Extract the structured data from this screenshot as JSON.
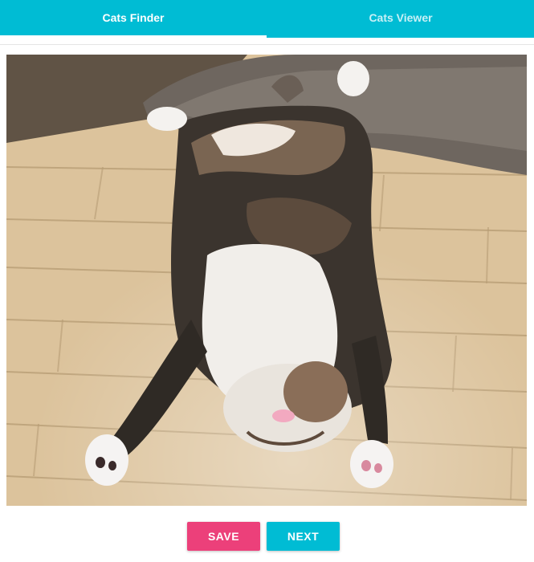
{
  "tabs": [
    {
      "label": "Cats Finder",
      "active": true
    },
    {
      "label": "Cats Viewer",
      "active": false
    }
  ],
  "actions": {
    "save_label": "SAVE",
    "next_label": "NEXT"
  },
  "colors": {
    "primary": "#00bcd4",
    "accent": "#ec407a"
  }
}
